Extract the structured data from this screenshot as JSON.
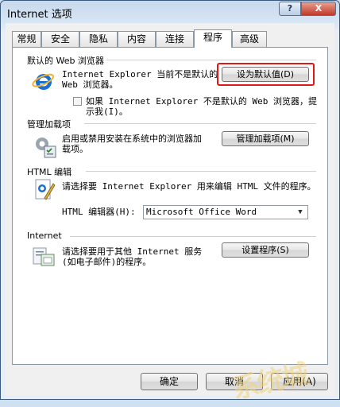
{
  "window": {
    "title": "Internet 选项",
    "help_label": "?",
    "close_label": "X"
  },
  "tabs": [
    {
      "label": "常规"
    },
    {
      "label": "安全"
    },
    {
      "label": "隐私"
    },
    {
      "label": "内容"
    },
    {
      "label": "连接"
    },
    {
      "label": "程序"
    },
    {
      "label": "高级"
    }
  ],
  "active_tab": "程序",
  "default_browser": {
    "heading": "默认的 Web 浏览器",
    "status_line1": "Internet Explorer 当前不是默认的",
    "status_line2": "Web 浏览器。",
    "make_default_label": "设为默认值(D)",
    "check_line1": "如果 Internet Explorer 不是默认的 Web 浏览器，提",
    "check_line2": "示我(I)。",
    "check_checked": false
  },
  "addons": {
    "heading": "管理加载项",
    "desc_line1": "启用或禁用安装在系统中的浏览器加",
    "desc_line2": "载项。",
    "button_label": "管理加载项(M)"
  },
  "html_editing": {
    "heading": "HTML 编辑",
    "desc": "请选择要 Internet Explorer 用来编辑 HTML 文件的程序。",
    "editor_label": "HTML 编辑器(H):",
    "editor_value": "Microsoft Office Word"
  },
  "internet_programs": {
    "heading": "Internet",
    "desc_line1": "请选择要用于其他 Internet 服务",
    "desc_line2": "(如电子邮件)的程序。",
    "button_label": "设置程序(S)"
  },
  "footer": {
    "ok_label": "确定",
    "cancel_label": "取消",
    "apply_label": "应用(A)"
  },
  "colors": {
    "highlight_ring": "#e01818",
    "ie_blue": "#1b6fd1"
  }
}
